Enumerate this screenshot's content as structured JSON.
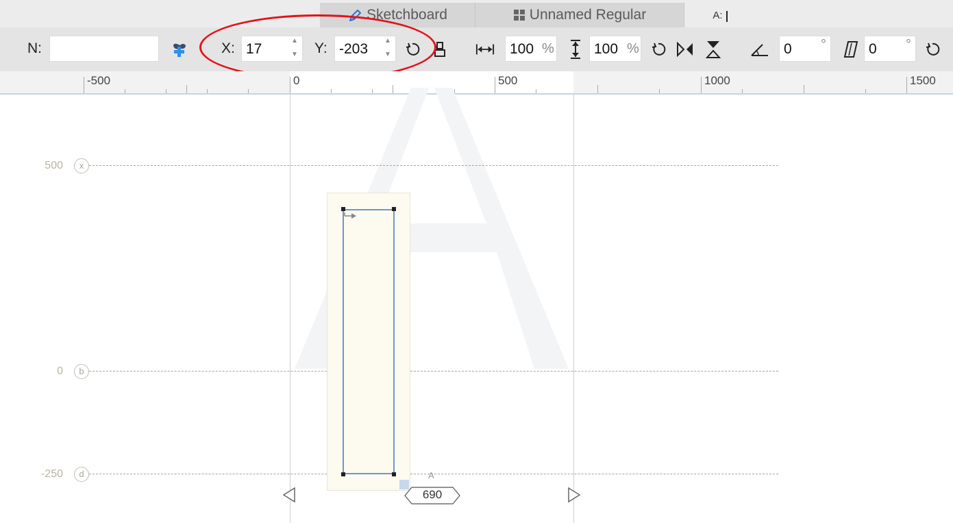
{
  "tabs": [
    {
      "label": "Sketchboard",
      "icon": "pen-icon"
    },
    {
      "label": "Unnamed Regular",
      "icon": "grid-icon"
    },
    {
      "label": "A:",
      "icon": ""
    }
  ],
  "toolbar": {
    "name_label": "N:",
    "name_value": "",
    "x_label": "X:",
    "x_value": "17",
    "y_label": "Y:",
    "y_value": "-203",
    "width_value": "100",
    "width_unit": "%",
    "height_value": "100",
    "height_unit": "%",
    "angle_value": "0",
    "angle_unit": "°",
    "slant_value": "0",
    "slant_unit": "°"
  },
  "ruler": {
    "labels": [
      "-500",
      "0",
      "500",
      "1000",
      "1500"
    ]
  },
  "metrics": {
    "lines": [
      {
        "value": "500",
        "key": "x"
      },
      {
        "value": "0",
        "key": "b"
      },
      {
        "value": "-250",
        "key": "d"
      }
    ],
    "advance_width": "690",
    "preview_glyph": "A",
    "corner_label": "A"
  },
  "colors": {
    "accent": "#6a98cc",
    "annotation": "#e3131a",
    "metric_label": "#b9b4a4"
  }
}
